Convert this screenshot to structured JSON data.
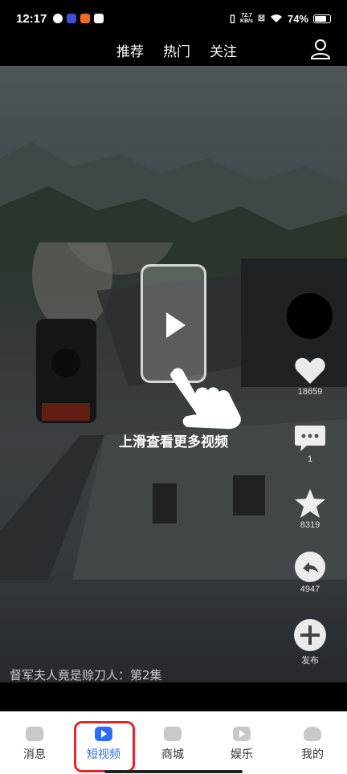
{
  "status_bar": {
    "time": "12:17",
    "speed_value": "72.7",
    "speed_unit": "KB/s",
    "battery": "74%"
  },
  "top_nav": {
    "tabs": [
      "推荐",
      "热门",
      "关注"
    ]
  },
  "video": {
    "hint_text": "上滑查看更多视频",
    "caption": "督军夫人竟是赊刀人：第2集",
    "actions": {
      "likes": "18659",
      "comments": "1",
      "favorites": "8319",
      "shares": "4947",
      "publish": "发布"
    }
  },
  "bottom_nav": {
    "items": [
      "消息",
      "短视频",
      "商城",
      "娱乐",
      "我的"
    ],
    "active": "短视频"
  },
  "colors": {
    "accent": "#2f6cf6",
    "highlight_box": "#e3242b"
  }
}
